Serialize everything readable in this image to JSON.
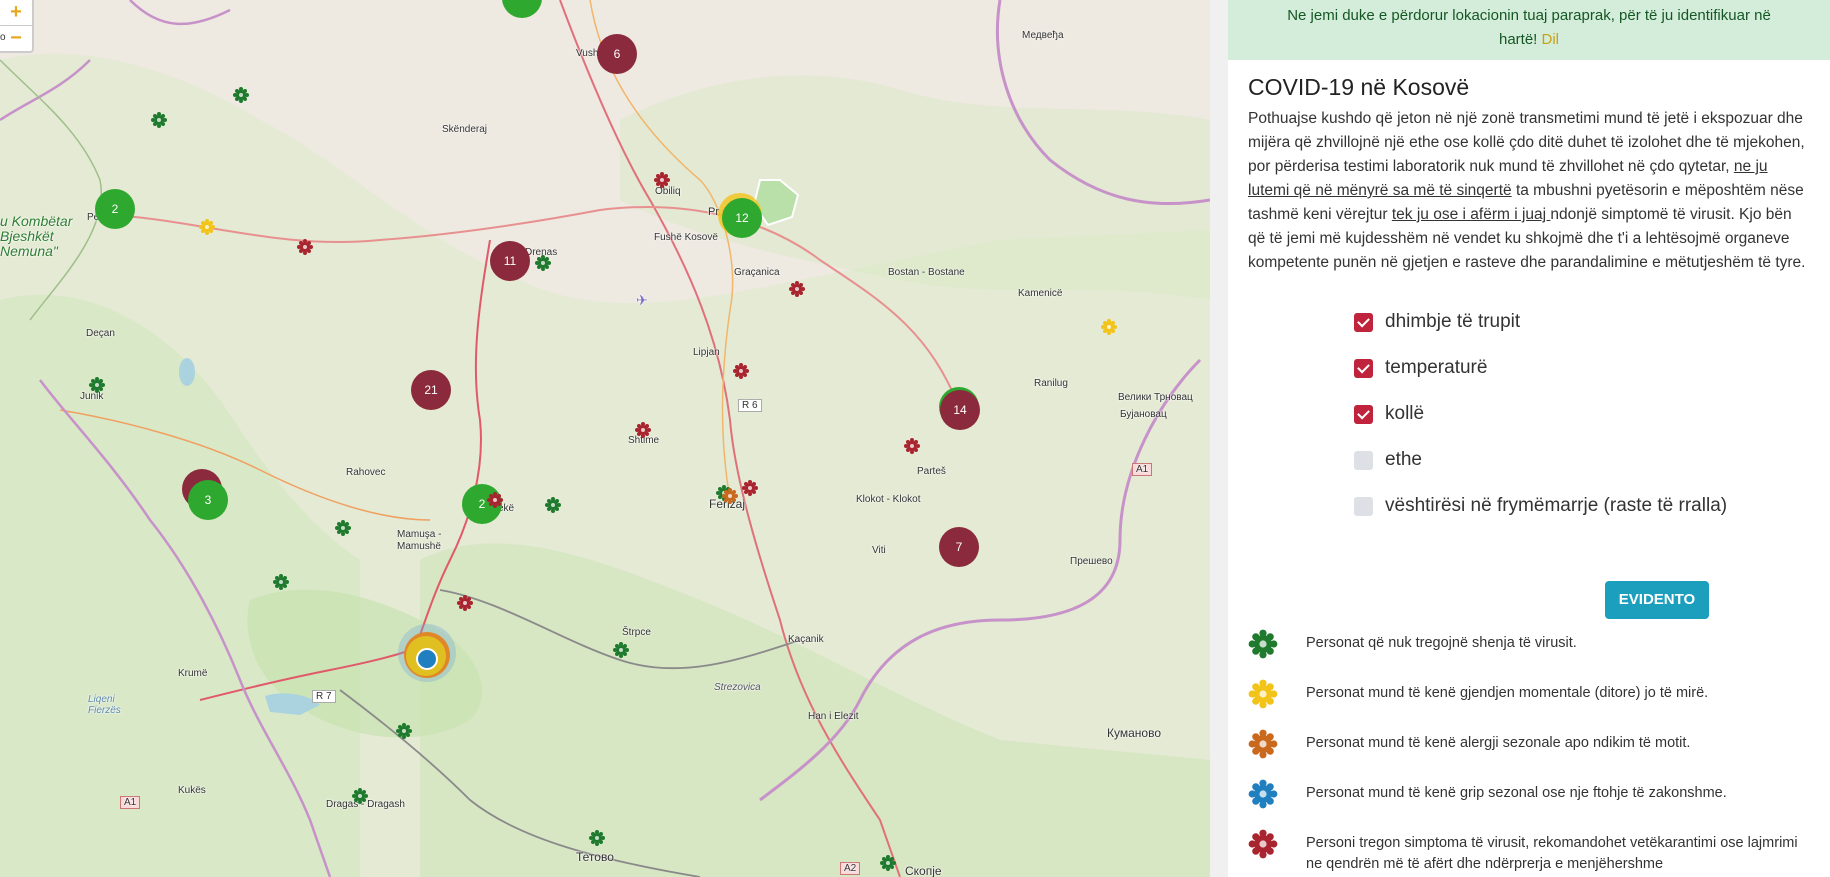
{
  "map": {
    "zoom_in": "+",
    "zoom_out": "−",
    "places": [
      {
        "id": "vushtrri",
        "text": "Vush"
      },
      {
        "id": "medvedja",
        "text": "Медвеђа"
      },
      {
        "id": "skenderaj",
        "text": "Skënderaj"
      },
      {
        "id": "obiliq",
        "text": "Obiliq"
      },
      {
        "id": "prishtine",
        "text": "Pr            ë"
      },
      {
        "id": "fushe",
        "text": "Fushë Kosovë"
      },
      {
        "id": "gracanica",
        "text": "Graçanica"
      },
      {
        "id": "bostan",
        "text": "Bostan - Bostane"
      },
      {
        "id": "kamenice",
        "text": "Kamenicë"
      },
      {
        "id": "drenas",
        "text": "Drenas"
      },
      {
        "id": "pe",
        "text": "Pe"
      },
      {
        "id": "decan",
        "text": "Deçan"
      },
      {
        "id": "junik",
        "text": "Junik"
      },
      {
        "id": "lipjan",
        "text": "Lipjan"
      },
      {
        "id": "shtime",
        "text": "Shtime"
      },
      {
        "id": "r6",
        "text": "R 6"
      },
      {
        "id": "ranilug",
        "text": "Ranilug"
      },
      {
        "id": "trnovac",
        "text": "Велики Трновац"
      },
      {
        "id": "bujanovac",
        "text": "Бујановац"
      },
      {
        "id": "a1a",
        "text": "A1"
      },
      {
        "id": "rahovec",
        "text": "Rahovec"
      },
      {
        "id": "partes",
        "text": "Parteš"
      },
      {
        "id": "klokot",
        "text": "Klokot - Klokot"
      },
      {
        "id": "ferizaj",
        "text": "Ferizaj"
      },
      {
        "id": "mamusa",
        "text": "Mamuşa -\nMamushë"
      },
      {
        "id": "viti",
        "text": "Viti"
      },
      {
        "id": "presevo",
        "text": "Прешево"
      },
      {
        "id": "strpce",
        "text": "Štrpce"
      },
      {
        "id": "kacanik",
        "text": "Kaçanik"
      },
      {
        "id": "krume",
        "text": "Krumë"
      },
      {
        "id": "strezovica",
        "text": "Strezovica"
      },
      {
        "id": "hani",
        "text": "Han i Elezit"
      },
      {
        "id": "kumanovo",
        "text": "Куманово"
      },
      {
        "id": "lqeni",
        "text": "Liqeni\nFierzës"
      },
      {
        "id": "r7",
        "text": "R 7"
      },
      {
        "id": "kukes",
        "text": "Kukës"
      },
      {
        "id": "a1b",
        "text": "A1"
      },
      {
        "id": "dragash",
        "text": "Dragaš - Dragash"
      },
      {
        "id": "tetovo",
        "text": "Тетово"
      },
      {
        "id": "a2",
        "text": "A2"
      },
      {
        "id": "skopje",
        "text": "Скопје"
      },
      {
        "id": "o",
        "text": "o"
      },
      {
        "id": "park",
        "text": "u Kombëtar\nBjeshkët\nNemuna\""
      },
      {
        "id": "eke",
        "text": "ekë"
      }
    ],
    "clusters": [
      {
        "id": "c6",
        "label": "6",
        "color": "red"
      },
      {
        "id": "c2a",
        "label": "2",
        "color": "green"
      },
      {
        "id": "c11",
        "label": "11",
        "color": "red"
      },
      {
        "id": "c12",
        "label": "12",
        "color": "green"
      },
      {
        "id": "c21",
        "label": "21",
        "color": "red"
      },
      {
        "id": "c14",
        "label": "14",
        "color": "red"
      },
      {
        "id": "c3",
        "label": "3",
        "color": "green"
      },
      {
        "id": "c2b",
        "label": "2",
        "color": "green"
      },
      {
        "id": "c7",
        "label": "7",
        "color": "red"
      }
    ]
  },
  "panel": {
    "alert_text": "Ne jemi duke e përdorur lokacionin tuaj paraprak, për të ju identifikuar në hartë!",
    "alert_link": "Dil",
    "title": "COVID-19 në Kosovë",
    "intro_1": "Pothuajse kushdo që jeton në një zonë transmetimi mund të jetë i ekspozuar dhe mijëra që zhvillojnë një ethe ose kollë çdo ditë duhet të izolohet dhe të mjekohen, por përderisa testimi laboratorik nuk mund të zhvillohet në çdo qytetar, ",
    "intro_u1": "ne ju lutemi që në mënyrë sa më të sinqertë",
    "intro_2": " ta mbushni pyetësorin e mëposhtëm nëse tashmë keni vërejtur ",
    "intro_u2": "tek ju ose i afërm i juaj ",
    "intro_3": "ndonjë simptomë të virusit. Kjo bën që të jemi më kujdesshëm në vendet ku shkojmë dhe t'i a lehtësojmë organeve kompetente punën në gjetjen e rasteve dhe parandalimine e mëtutjeshëm të tyre.",
    "symptoms": [
      {
        "label": "dhimbje të trupit",
        "checked": true
      },
      {
        "label": "temperaturë",
        "checked": true
      },
      {
        "label": "kollë",
        "checked": true
      },
      {
        "label": "ethe",
        "checked": false
      },
      {
        "label": "vështirësi në frymëmarrje (raste të rralla)",
        "checked": false
      }
    ],
    "button": "EVIDENTO",
    "legend": [
      {
        "color": "#1f7a2e",
        "text": "Personat që nuk tregojnë shenja të virusit."
      },
      {
        "color": "#f2c318",
        "text": "Personat mund të kenë gjendjen momentale (ditore) jo të mirë."
      },
      {
        "color": "#c8691e",
        "text": "Personat mund të kenë alergji sezonale apo ndikim të motit."
      },
      {
        "color": "#1f7fbf",
        "text": "Personat mund të kenë grip sezonal ose nje ftohje të zakonshme."
      },
      {
        "color": "#a8242f",
        "text": "Personi tregon simptoma të virusit, rekomandohet vetëkarantimi ose lajmrimi ne qendrën më të afërt dhe ndërprerja e menjëhershme"
      }
    ]
  },
  "colors": {
    "accent": "#1c9fbd",
    "checkbox": "#c0243c",
    "alert_bg": "#d4edda"
  }
}
